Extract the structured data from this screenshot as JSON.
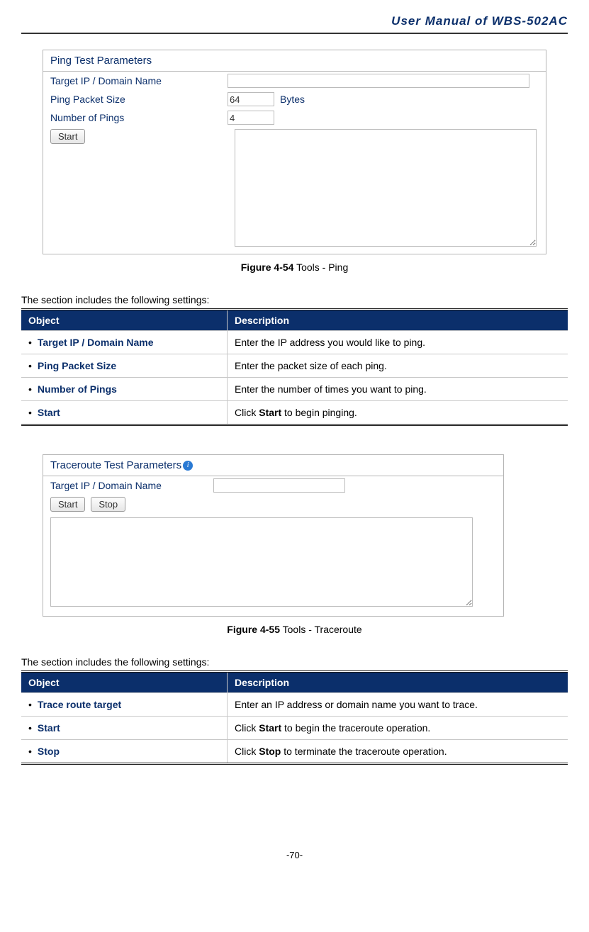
{
  "header": {
    "title": "User Manual of WBS-502AC"
  },
  "pingPanel": {
    "title": "Ping Test Parameters",
    "rows": {
      "target": {
        "label": "Target IP / Domain Name",
        "value": ""
      },
      "size": {
        "label": "Ping Packet Size",
        "value": "64",
        "unit": "Bytes"
      },
      "count": {
        "label": "Number of Pings",
        "value": "4"
      }
    },
    "startBtn": "Start"
  },
  "figure54": {
    "num": "Figure 4-54",
    "caption": " Tools - Ping"
  },
  "intro1": "The section includes the following settings:",
  "table1": {
    "head": {
      "obj": "Object",
      "dsc": "Description"
    },
    "rows": [
      {
        "obj": "Target IP / Domain Name",
        "dsc_pre": "Enter the IP address you would like to ping.",
        "strong": "",
        "dsc_post": ""
      },
      {
        "obj": "Ping Packet Size",
        "dsc_pre": "Enter the packet size of each ping.",
        "strong": "",
        "dsc_post": ""
      },
      {
        "obj": "Number of Pings",
        "dsc_pre": "Enter the number of times you want to ping.",
        "strong": "",
        "dsc_post": ""
      },
      {
        "obj": "Start",
        "dsc_pre": "Click ",
        "strong": "Start",
        "dsc_post": " to begin pinging."
      }
    ]
  },
  "tracePanel": {
    "title": "Traceroute Test Parameters",
    "target": {
      "label": "Target IP / Domain Name",
      "value": ""
    },
    "startBtn": "Start",
    "stopBtn": "Stop"
  },
  "figure55": {
    "num": "Figure 4-55",
    "caption": " Tools - Traceroute"
  },
  "intro2": "The section includes the following settings:",
  "table2": {
    "head": {
      "obj": "Object",
      "dsc": "Description"
    },
    "rows": [
      {
        "obj": "Trace route target",
        "dsc_pre": "Enter an IP address or domain name you want to trace.",
        "strong": "",
        "dsc_post": ""
      },
      {
        "obj": "Start",
        "dsc_pre": "Click ",
        "strong": "Start",
        "dsc_post": " to begin the traceroute operation."
      },
      {
        "obj": "Stop",
        "dsc_pre": "Click ",
        "strong": "Stop",
        "dsc_post": " to terminate the traceroute operation."
      }
    ]
  },
  "footer": {
    "page": "-70-"
  }
}
